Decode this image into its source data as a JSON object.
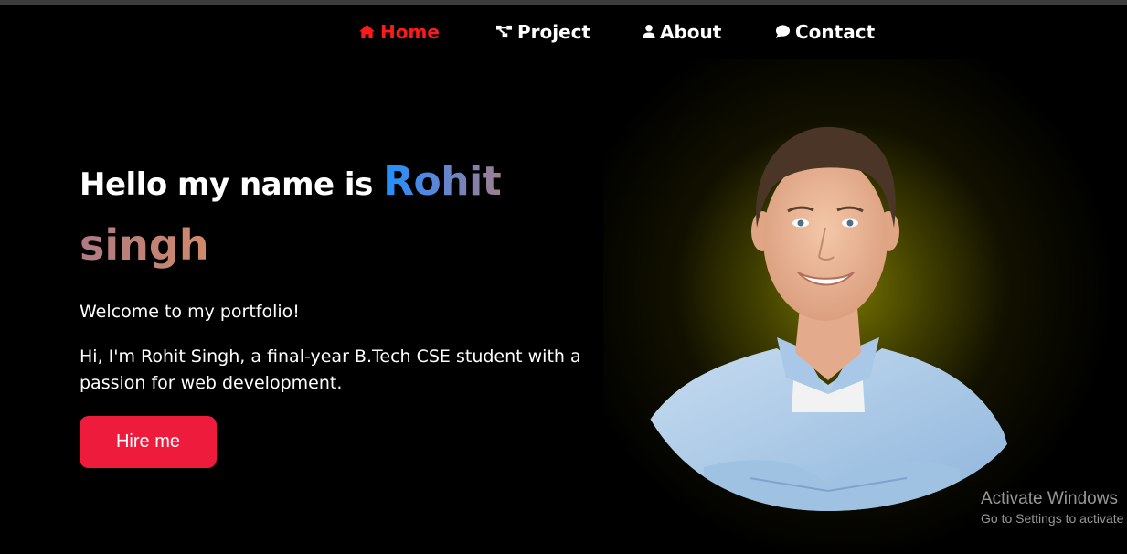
{
  "nav": {
    "items": [
      {
        "label": "Home",
        "icon": "home-icon",
        "active": true
      },
      {
        "label": "Project",
        "icon": "project-icon",
        "active": false
      },
      {
        "label": "About",
        "icon": "user-icon",
        "active": false
      },
      {
        "label": "Contact",
        "icon": "chat-icon",
        "active": false
      }
    ],
    "active_color": "#ff1a1a"
  },
  "hero": {
    "greeting": "Hello my name is ",
    "first_name": "Rohit",
    "last_name": "singh",
    "welcome": "Welcome to my portfolio!",
    "intro": "Hi, I'm Rohit Singh, a final-year B.Tech CSE student with a passion for web development.",
    "hire_label": "Hire me",
    "hire_color": "#ee1b3d",
    "glow_color": "#7e7c00"
  },
  "watermark": {
    "title": "Activate Windows",
    "subtitle": "Go to Settings to activate Windows."
  }
}
